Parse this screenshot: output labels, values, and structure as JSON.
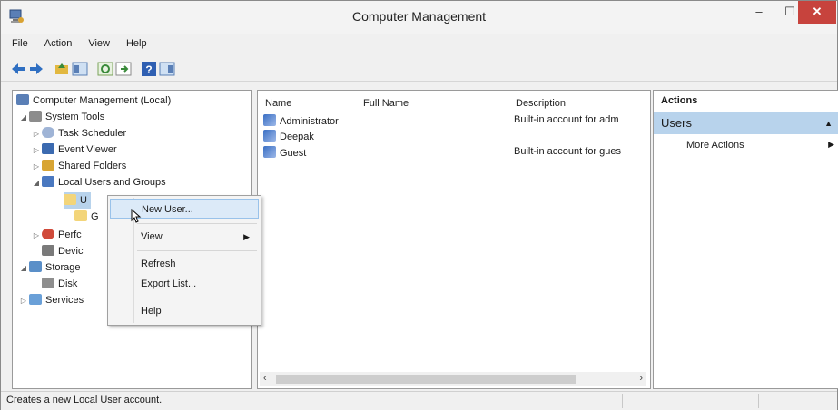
{
  "window": {
    "title": "Computer Management",
    "minimize": "–",
    "maximize": "☐",
    "close": "✕"
  },
  "menu": [
    "File",
    "Action",
    "View",
    "Help"
  ],
  "tree": [
    {
      "label": "Computer Management (Local)",
      "level": 0,
      "twisty": ""
    },
    {
      "label": "System Tools",
      "level": 1,
      "twisty": "◢"
    },
    {
      "label": "Task Scheduler",
      "level": 2,
      "twisty": "▷"
    },
    {
      "label": "Event Viewer",
      "level": 2,
      "twisty": "▷"
    },
    {
      "label": "Shared Folders",
      "level": 2,
      "twisty": "▷"
    },
    {
      "label": "Local Users and Groups",
      "level": 2,
      "twisty": "◢"
    },
    {
      "label": "U",
      "level": 3,
      "twisty": ""
    },
    {
      "label": "G",
      "level": 3,
      "twisty": ""
    },
    {
      "label": "Perfc",
      "level": 2,
      "twisty": "▷"
    },
    {
      "label": "Devic",
      "level": 2,
      "twisty": ""
    },
    {
      "label": "Storage",
      "level": 1,
      "twisty": "◢"
    },
    {
      "label": "Disk",
      "level": 2,
      "twisty": ""
    },
    {
      "label": "Services",
      "level": 1,
      "twisty": "▷"
    }
  ],
  "list": {
    "columns": [
      "Name",
      "Full Name",
      "Description"
    ],
    "rows": [
      {
        "name": "Administrator",
        "full_name": "",
        "description": "Built-in account for adm"
      },
      {
        "name": "Deepak",
        "full_name": "",
        "description": ""
      },
      {
        "name": "Guest",
        "full_name": "",
        "description": "Built-in account for gues"
      }
    ]
  },
  "actions": {
    "header": "Actions",
    "section": "Users",
    "more": "More Actions"
  },
  "context_menu": {
    "new_user": "New User...",
    "view": "View",
    "refresh": "Refresh",
    "export": "Export List...",
    "help": "Help"
  },
  "status": {
    "text": "Creates a new Local User account."
  },
  "colors": {
    "selection": "#b8d3ec",
    "menu_highlight": "#dceaf8",
    "close_button": "#c7433d"
  }
}
